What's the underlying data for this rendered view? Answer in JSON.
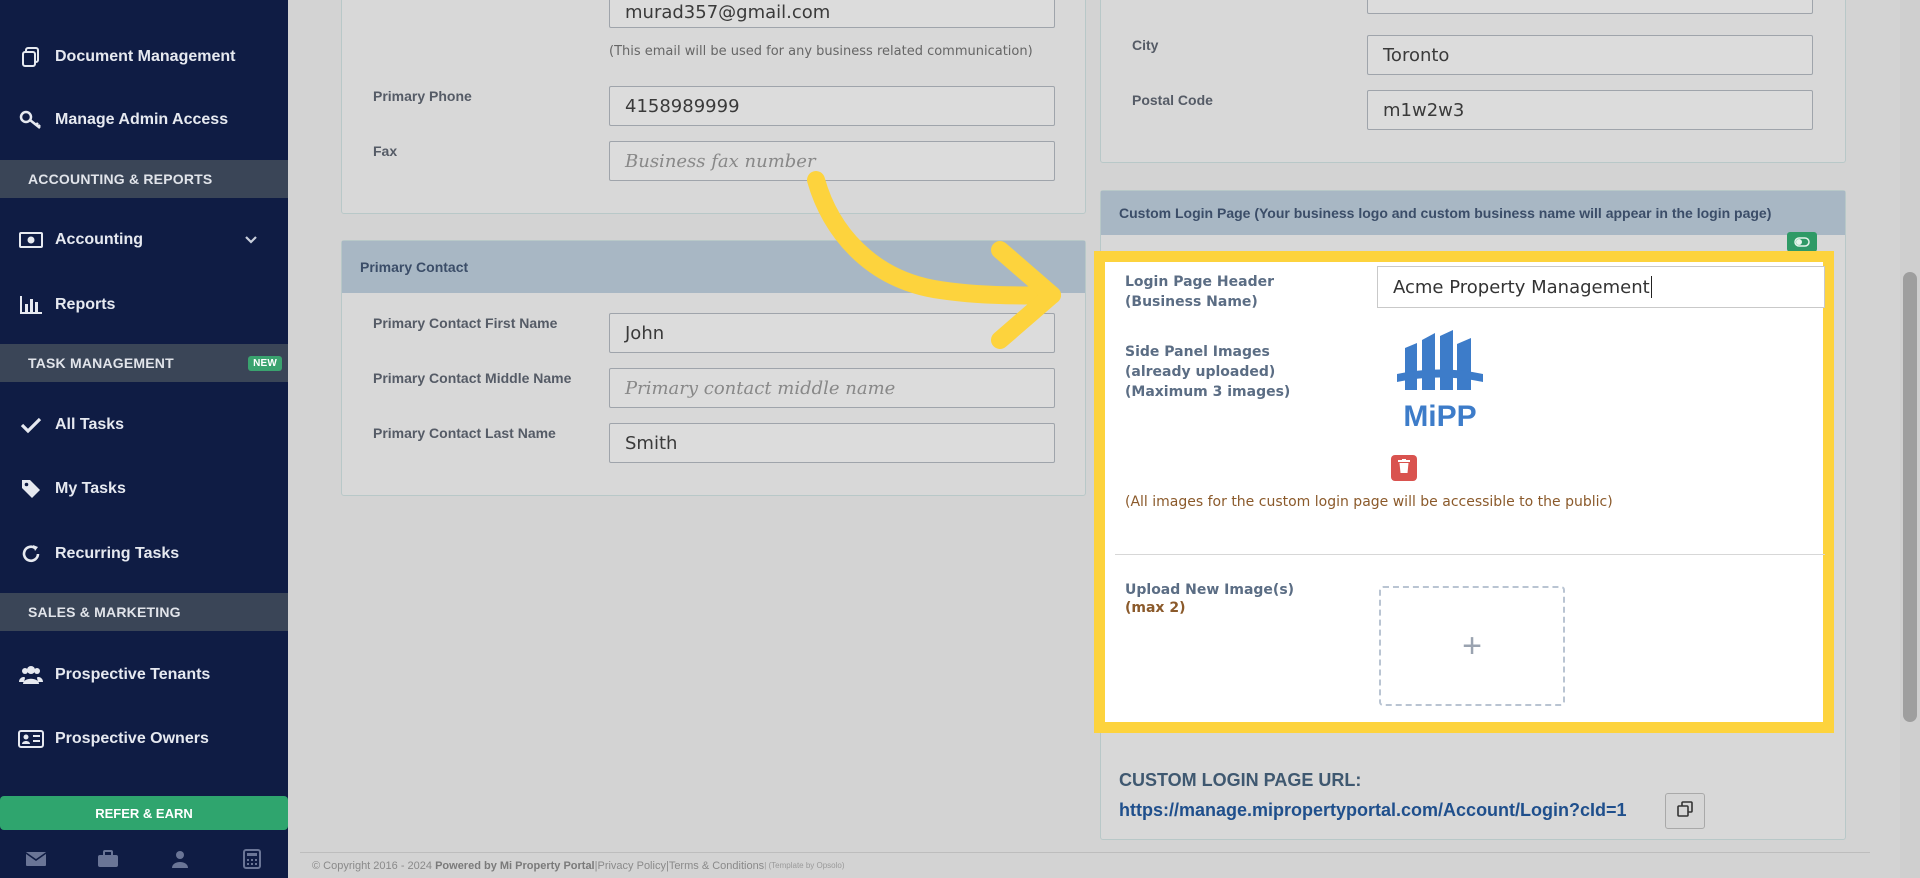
{
  "sidebar": {
    "items_top": [
      {
        "label": "Document Management",
        "icon": "documents-icon"
      },
      {
        "label": "Manage Admin Access",
        "icon": "key-icon"
      }
    ],
    "section_accounting": "ACCOUNTING & REPORTS",
    "accounting": {
      "label": "Accounting",
      "icon": "money-icon"
    },
    "reports": {
      "label": "Reports",
      "icon": "bar-chart-icon"
    },
    "section_tasks": "TASK MANAGEMENT",
    "new_badge": "NEW",
    "tasks": [
      {
        "label": "All Tasks",
        "icon": "check-icon"
      },
      {
        "label": "My Tasks",
        "icon": "tag-icon"
      },
      {
        "label": "Recurring Tasks",
        "icon": "refresh-icon"
      }
    ],
    "section_sales": "SALES & MARKETING",
    "sales": [
      {
        "label": "Prospective Tenants",
        "icon": "users-icon"
      },
      {
        "label": "Prospective Owners",
        "icon": "id-card-icon"
      }
    ],
    "refer_label": "REFER & EARN"
  },
  "business": {
    "email_value": "murad357@gmail.com",
    "email_help": "(This email will be used for any business related communication)",
    "phone_label": "Primary Phone",
    "phone_value": "4158989999",
    "fax_label": "Fax",
    "fax_placeholder": "Business fax number"
  },
  "contact": {
    "header": "Primary Contact",
    "first_label": "Primary Contact First Name",
    "first_value": "John",
    "middle_label": "Primary Contact Middle Name",
    "middle_placeholder": "Primary contact middle name",
    "last_label": "Primary Contact Last Name",
    "last_value": "Smith"
  },
  "address": {
    "city_label": "City",
    "city_value": "Toronto",
    "postal_label": "Postal Code",
    "postal_value": "m1w2w3"
  },
  "custom_login": {
    "header": "Custom Login Page (Your business logo and custom business name will appear in the login page)",
    "header_field_label": "Login Page Header (Business Name)",
    "header_field_value": "Acme Property Management",
    "side_images_label": "Side Panel Images (already uploaded)",
    "side_images_max": "(Maximum 3 images)",
    "logo_text": "MiPP",
    "public_note": "(All images for the custom login page will be accessible to the public)",
    "upload_label": "Upload New Image(s)",
    "upload_max": "(max 2)",
    "upload_plus": "+",
    "url_label": "CUSTOM LOGIN PAGE URL:",
    "url_value": "https://manage.mipropertyportal.com/Account/Login?cId=1"
  },
  "footer": {
    "copyright": "© Copyright 2016 - 2024",
    "powered": "Powered by Mi Property Portal",
    "sep1": " | ",
    "privacy": "Privacy Policy",
    "sep2": " | ",
    "terms": "Terms & Conditions",
    "template": " | (Template by Opsolo)"
  },
  "colors": {
    "sidebar_bg": "#0f1c44",
    "highlight": "#fdd33d",
    "refer_green": "#2fa56e",
    "logo_blue": "#3d7cc9",
    "link_blue": "#1f4f8c"
  }
}
